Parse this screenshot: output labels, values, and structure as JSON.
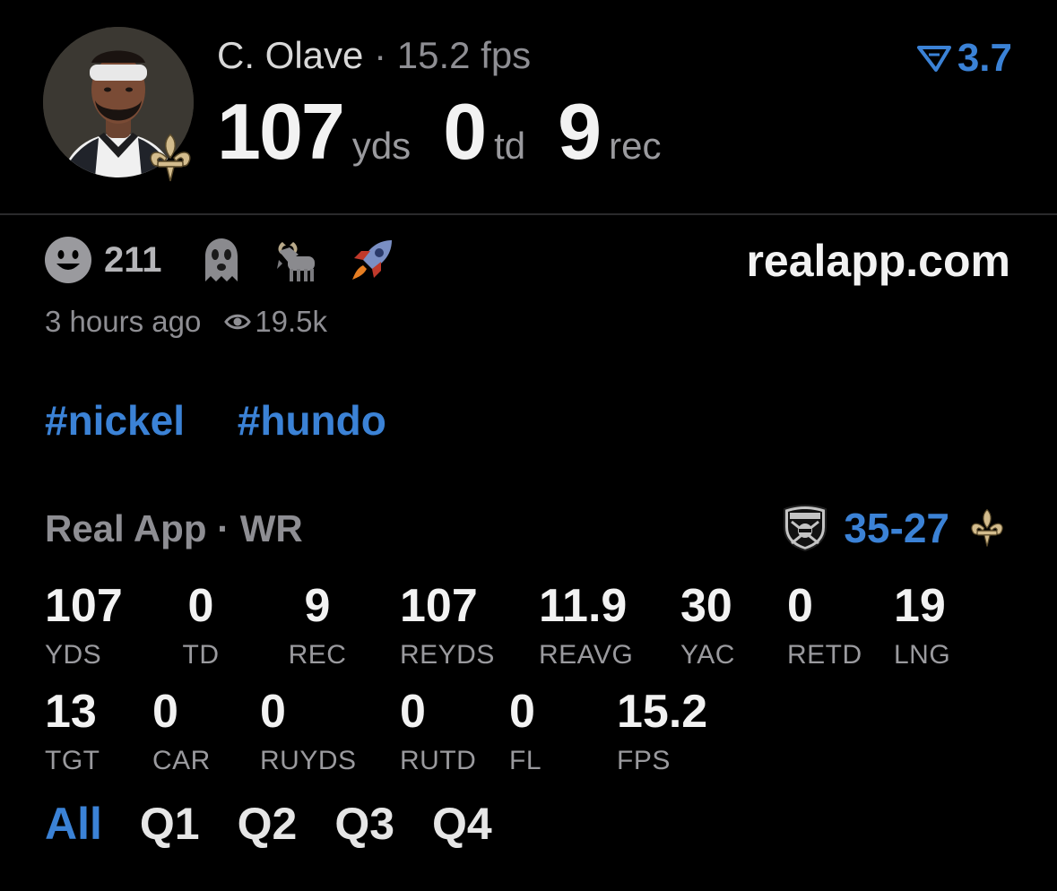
{
  "header": {
    "player_name": "C. Olave",
    "separator": "·",
    "fps_text": "15.2 fps",
    "rating": "3.7",
    "stats": [
      {
        "value": "107",
        "unit": "yds"
      },
      {
        "value": "0",
        "unit": "td"
      },
      {
        "value": "9",
        "unit": "rec"
      }
    ]
  },
  "reactions": {
    "count": "211",
    "icons": [
      "smiley-icon",
      "ghost-icon",
      "goat-icon",
      "rocket-icon"
    ]
  },
  "site": "realapp.com",
  "meta": {
    "time_ago": "3 hours ago",
    "views": "19.5k"
  },
  "tags": [
    "#nickel",
    "#hundo"
  ],
  "game": {
    "label": "Real App · WR",
    "score_left": "35",
    "score_dash": "-",
    "score_right": "27"
  },
  "stats_row1": [
    {
      "value": "107",
      "label": "YDS"
    },
    {
      "value": "0",
      "label": "TD"
    },
    {
      "value": "9",
      "label": "REC"
    },
    {
      "value": "107",
      "label": "REYDS"
    },
    {
      "value": "11.9",
      "label": "REAVG"
    },
    {
      "value": "30",
      "label": "YAC"
    },
    {
      "value": "0",
      "label": "RETD"
    },
    {
      "value": "19",
      "label": "LNG"
    }
  ],
  "stats_row2": [
    {
      "value": "13",
      "label": "TGT"
    },
    {
      "value": "0",
      "label": "CAR"
    },
    {
      "value": "0",
      "label": "RUYDS"
    },
    {
      "value": "0",
      "label": "RUTD"
    },
    {
      "value": "0",
      "label": "FL"
    },
    {
      "value": "15.2",
      "label": "FPS"
    }
  ],
  "quarters": [
    "All",
    "Q1",
    "Q2",
    "Q3",
    "Q4"
  ],
  "active_quarter": "All",
  "colors": {
    "accent": "#3b82d6",
    "background": "#000000",
    "muted": "#8e8e93",
    "saints_gold": "#d3bc8d"
  }
}
